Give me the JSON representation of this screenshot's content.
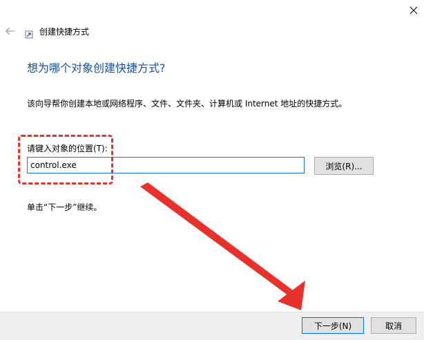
{
  "window": {
    "close_glyph": "✕",
    "back_glyph": "←"
  },
  "wizard": {
    "title": "创建快捷方式",
    "heading": "想为哪个对象创建快捷方式?",
    "description": "该向导帮你创建本地或网络程序、文件、文件夹、计算机或 Internet 地址的快捷方式。",
    "location_label": "请键入对象的位置(T):",
    "location_value": "control.exe",
    "browse_label": "浏览(R)...",
    "hint": "单击“下一步”继续。"
  },
  "footer": {
    "next_label": "下一步(N)",
    "cancel_label": "取消"
  },
  "annotation": {
    "highlight_color": "#e8312a",
    "arrow_color": "#e8312a"
  },
  "colors": {
    "heading": "#1a4fa3",
    "accent": "#0078d7",
    "footer_bg": "#f0f0f0"
  }
}
